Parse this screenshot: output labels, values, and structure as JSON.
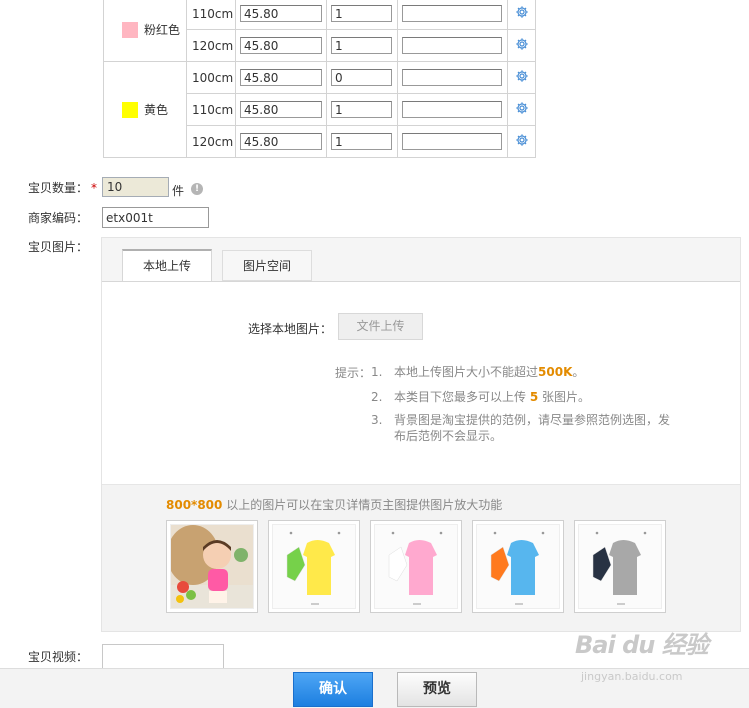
{
  "sku_table": {
    "groups": [
      {
        "color": "粉红色",
        "swatch": "#ffb6c1",
        "rows": [
          {
            "size": "110cm",
            "price": "45.80",
            "qty": "1",
            "code": ""
          },
          {
            "size": "120cm",
            "price": "45.80",
            "qty": "1",
            "code": ""
          }
        ]
      },
      {
        "color": "黄色",
        "swatch": "#ffff00",
        "rows": [
          {
            "size": "100cm",
            "price": "45.80",
            "qty": "0",
            "code": ""
          },
          {
            "size": "110cm",
            "price": "45.80",
            "qty": "1",
            "code": ""
          },
          {
            "size": "120cm",
            "price": "45.80",
            "qty": "1",
            "code": ""
          }
        ]
      }
    ],
    "gear_icon": "gear-icon"
  },
  "quantity": {
    "label": "宝贝数量：",
    "required_mark": "*",
    "value": "10",
    "unit": "件",
    "help_icon": "info-icon",
    "help_glyph": "!"
  },
  "merchant_code": {
    "label": "商家编码：",
    "value": "etx001t"
  },
  "images": {
    "label": "宝贝图片：",
    "tabs": [
      {
        "label": "本地上传",
        "active": true
      },
      {
        "label": "图片空间",
        "active": false
      }
    ],
    "choose_label": "选择本地图片：",
    "upload_button": "文件上传",
    "tips_label": "提示：",
    "tips": [
      {
        "num": "1.",
        "before": "本地上传图片大小不能超过",
        "highlight": "500K",
        "after": "。"
      },
      {
        "num": "2.",
        "before": "本类目下您最多可以上传 ",
        "highlight": "5",
        "after": " 张图片。"
      },
      {
        "num": "3.",
        "before": "背景图是淘宝提供的范例，请尽量参照范例选图，发布后范例不会显示。",
        "highlight": "",
        "after": ""
      }
    ],
    "gallery_note_highlight": "800*800",
    "gallery_note": " 以上的图片可以在宝贝详情页主图提供图片放大功能",
    "thumbnails": [
      {
        "kind": "photo",
        "item": "pink",
        "accent": "#ff5aa5"
      },
      {
        "kind": "clothes",
        "item": "yellow",
        "accent": "#ffe94a",
        "side": "#76d14a"
      },
      {
        "kind": "clothes",
        "item": "pink",
        "accent": "#ffa9cf",
        "side": "#ffffff"
      },
      {
        "kind": "clothes",
        "item": "blue",
        "accent": "#57b6ee",
        "side": "#ff7a1e"
      },
      {
        "kind": "clothes",
        "item": "gray",
        "accent": "#a8a8a8",
        "side": "#283243"
      }
    ]
  },
  "video": {
    "label": "宝贝视频："
  },
  "footer": {
    "confirm": "确认",
    "preview": "预览"
  },
  "watermark": {
    "logo": "Bai du 经验",
    "url": "jingyan.baidu.com"
  }
}
